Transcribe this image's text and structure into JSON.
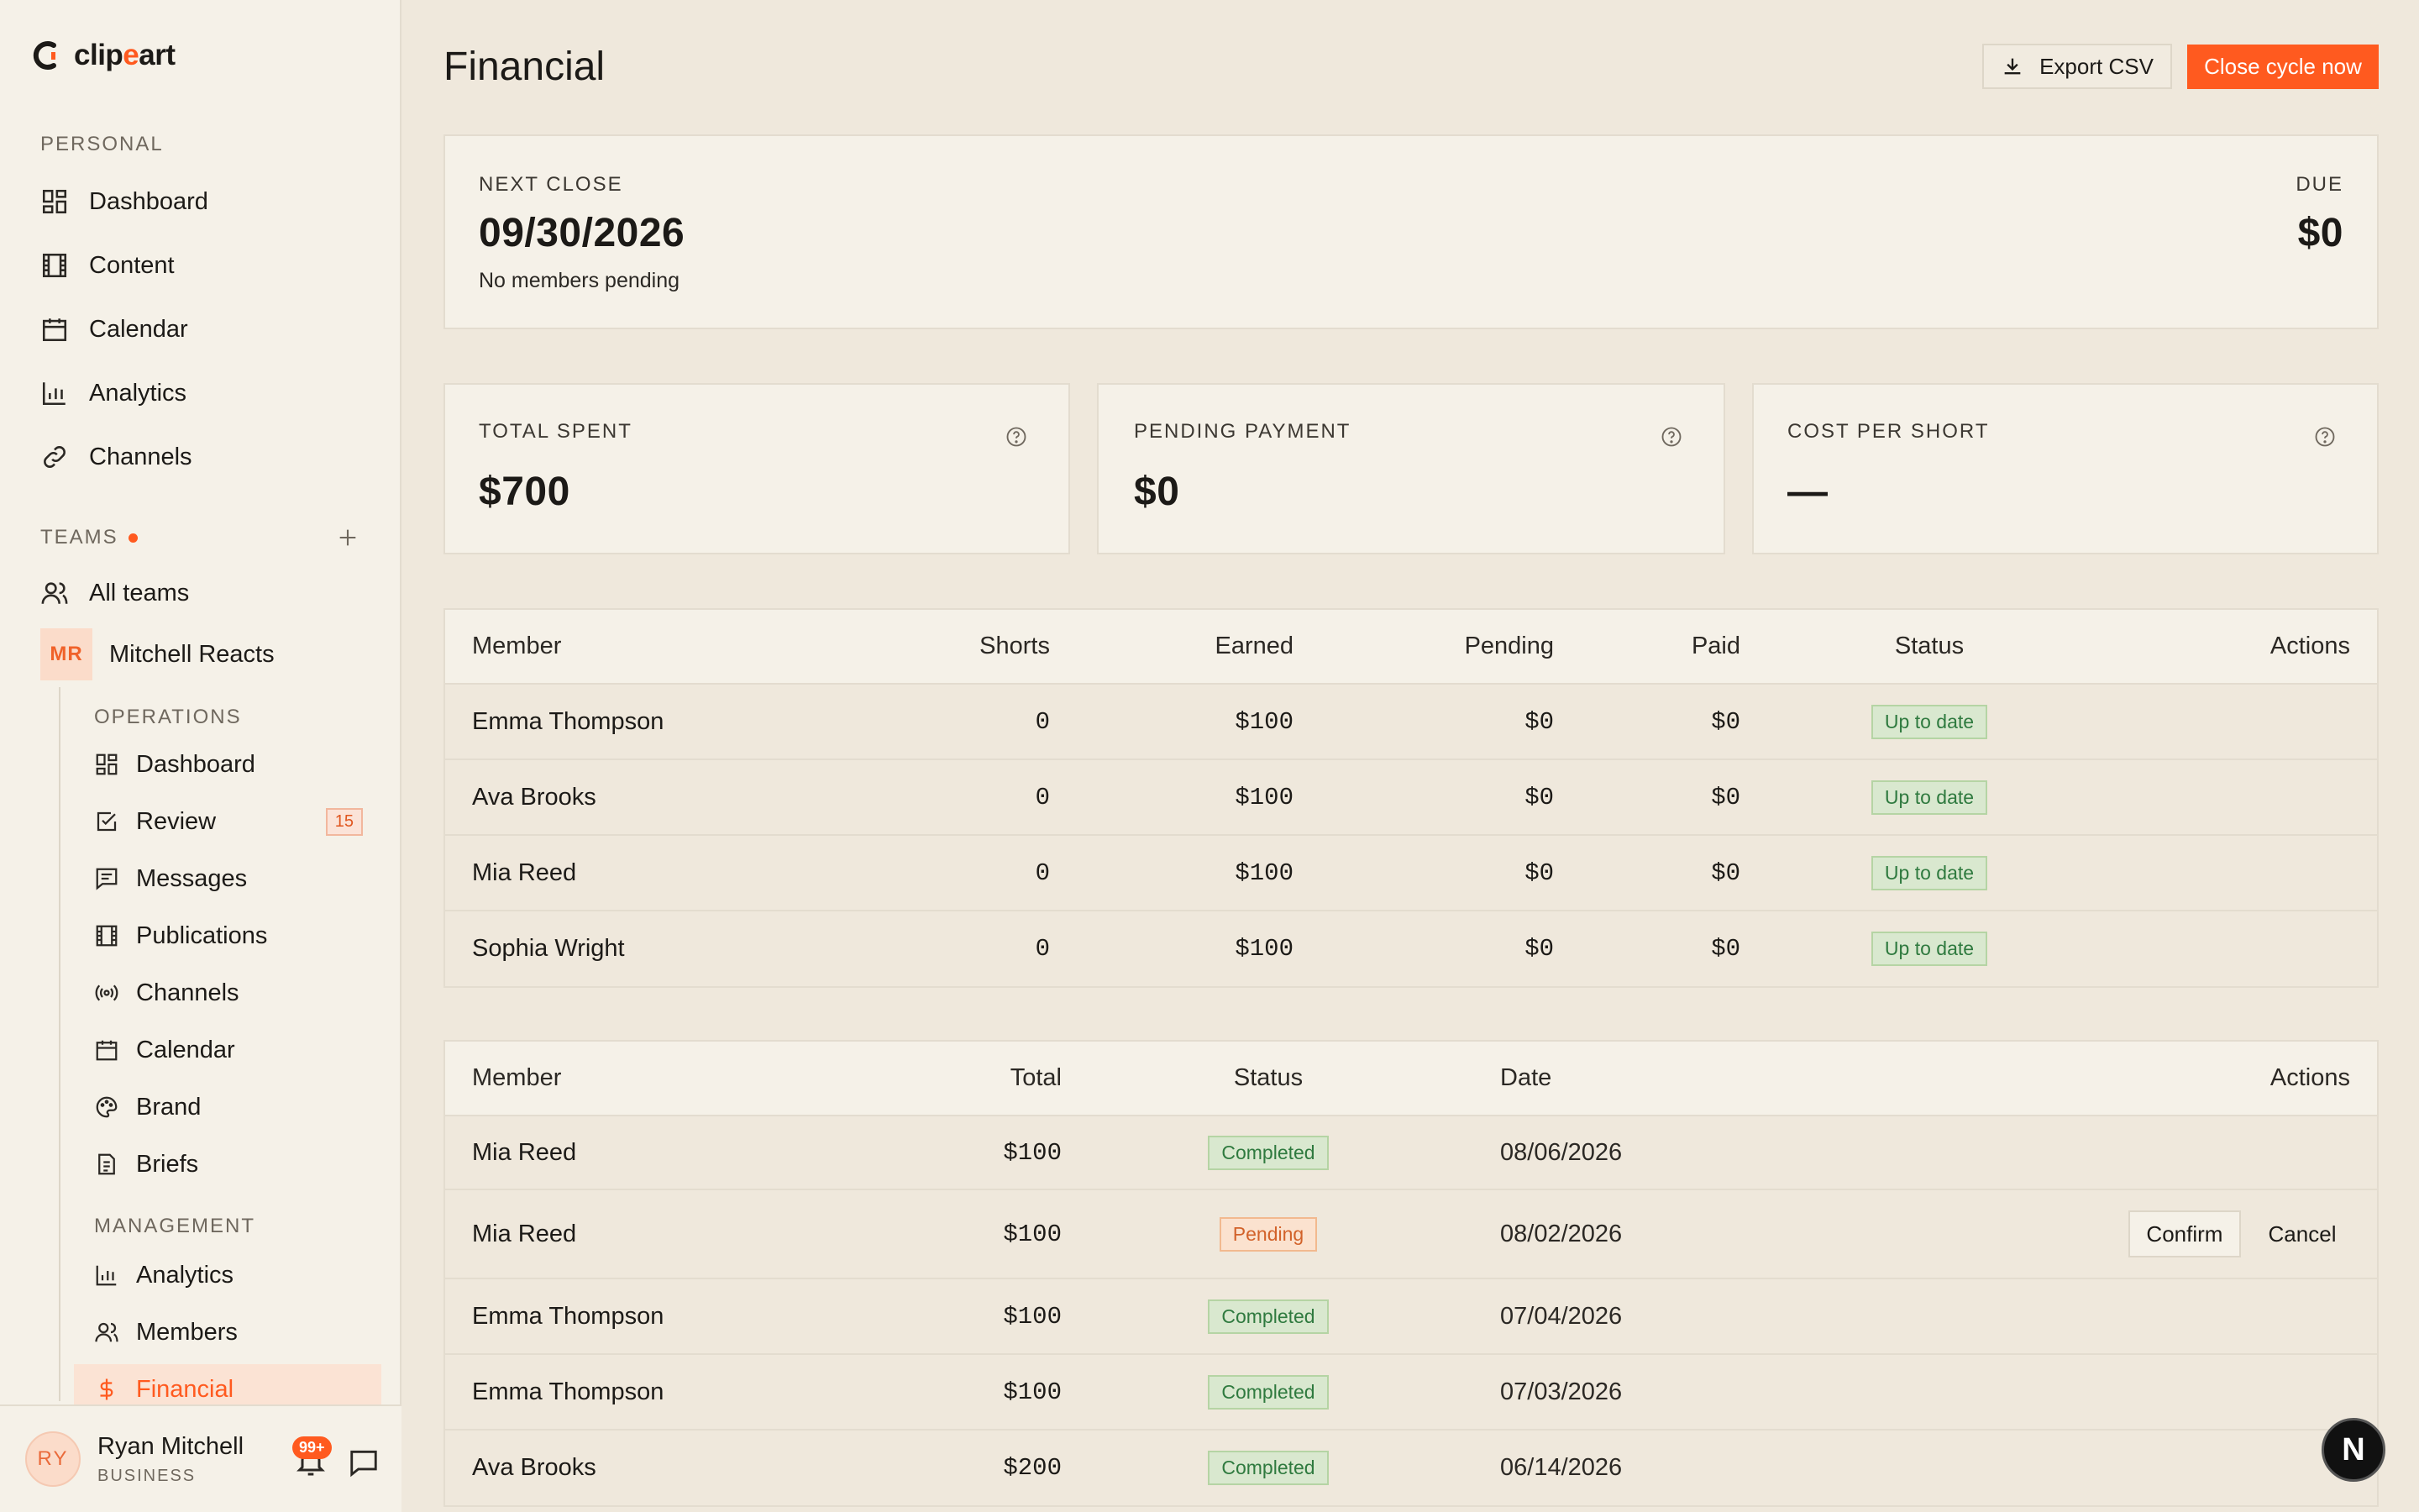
{
  "app": {
    "logo_prefix": "clip",
    "logo_accent": "e",
    "logo_suffix": "art",
    "accent_color": "#ff5a1f"
  },
  "sidebar": {
    "personal_label": "PERSONAL",
    "personal_items": [
      {
        "label": "Dashboard",
        "icon": "dashboard-icon"
      },
      {
        "label": "Content",
        "icon": "film-icon"
      },
      {
        "label": "Calendar",
        "icon": "calendar-icon"
      },
      {
        "label": "Analytics",
        "icon": "bar-chart-icon"
      },
      {
        "label": "Channels",
        "icon": "link-icon"
      }
    ],
    "teams_label": "TEAMS",
    "all_teams_label": "All teams",
    "team": {
      "initials": "MR",
      "name": "Mitchell Reacts"
    },
    "operations_label": "OPERATIONS",
    "operations_items": [
      {
        "label": "Dashboard",
        "icon": "dashboard-icon"
      },
      {
        "label": "Review",
        "icon": "checkbox-icon",
        "badge": "15"
      },
      {
        "label": "Messages",
        "icon": "message-icon"
      },
      {
        "label": "Publications",
        "icon": "film-icon"
      },
      {
        "label": "Channels",
        "icon": "broadcast-icon"
      },
      {
        "label": "Calendar",
        "icon": "calendar-icon"
      },
      {
        "label": "Brand",
        "icon": "palette-icon"
      },
      {
        "label": "Briefs",
        "icon": "document-icon"
      }
    ],
    "management_label": "MANAGEMENT",
    "management_items": [
      {
        "label": "Analytics",
        "icon": "bar-chart-icon"
      },
      {
        "label": "Members",
        "icon": "users-icon"
      },
      {
        "label": "Financial",
        "icon": "dollar-icon",
        "active": true
      }
    ],
    "user": {
      "initials": "RY",
      "name": "Ryan Mitchell",
      "plan": "BUSINESS",
      "notifications": "99+"
    }
  },
  "header": {
    "title": "Financial",
    "export_label": "Export CSV",
    "close_cycle_label": "Close cycle now"
  },
  "next_close": {
    "label": "NEXT CLOSE",
    "date": "09/30/2026",
    "note": "No members pending",
    "due_label": "DUE",
    "due_value": "$0"
  },
  "stats": [
    {
      "label": "TOTAL SPENT",
      "value": "$700"
    },
    {
      "label": "PENDING PAYMENT",
      "value": "$0"
    },
    {
      "label": "COST PER SHORT",
      "value": "—"
    }
  ],
  "members_table": {
    "columns": [
      "Member",
      "Shorts",
      "Earned",
      "Pending",
      "Paid",
      "Status",
      "Actions"
    ],
    "rows": [
      {
        "member": "Emma Thompson",
        "shorts": "0",
        "earned": "$100",
        "pending": "$0",
        "paid": "$0",
        "status": "Up to date"
      },
      {
        "member": "Ava Brooks",
        "shorts": "0",
        "earned": "$100",
        "pending": "$0",
        "paid": "$0",
        "status": "Up to date"
      },
      {
        "member": "Mia Reed",
        "shorts": "0",
        "earned": "$100",
        "pending": "$0",
        "paid": "$0",
        "status": "Up to date"
      },
      {
        "member": "Sophia Wright",
        "shorts": "0",
        "earned": "$100",
        "pending": "$0",
        "paid": "$0",
        "status": "Up to date"
      }
    ]
  },
  "payouts_table": {
    "columns": [
      "Member",
      "Total",
      "Status",
      "Date",
      "Actions"
    ],
    "rows": [
      {
        "member": "Mia Reed",
        "total": "$100",
        "status": "Completed",
        "date": "08/06/2026"
      },
      {
        "member": "Mia Reed",
        "total": "$100",
        "status": "Pending",
        "date": "08/02/2026",
        "confirm": "Confirm",
        "cancel": "Cancel"
      },
      {
        "member": "Emma Thompson",
        "total": "$100",
        "status": "Completed",
        "date": "07/04/2026"
      },
      {
        "member": "Emma Thompson",
        "total": "$100",
        "status": "Completed",
        "date": "07/03/2026"
      },
      {
        "member": "Ava Brooks",
        "total": "$200",
        "status": "Completed",
        "date": "06/14/2026"
      }
    ]
  },
  "dev_badge": "N"
}
